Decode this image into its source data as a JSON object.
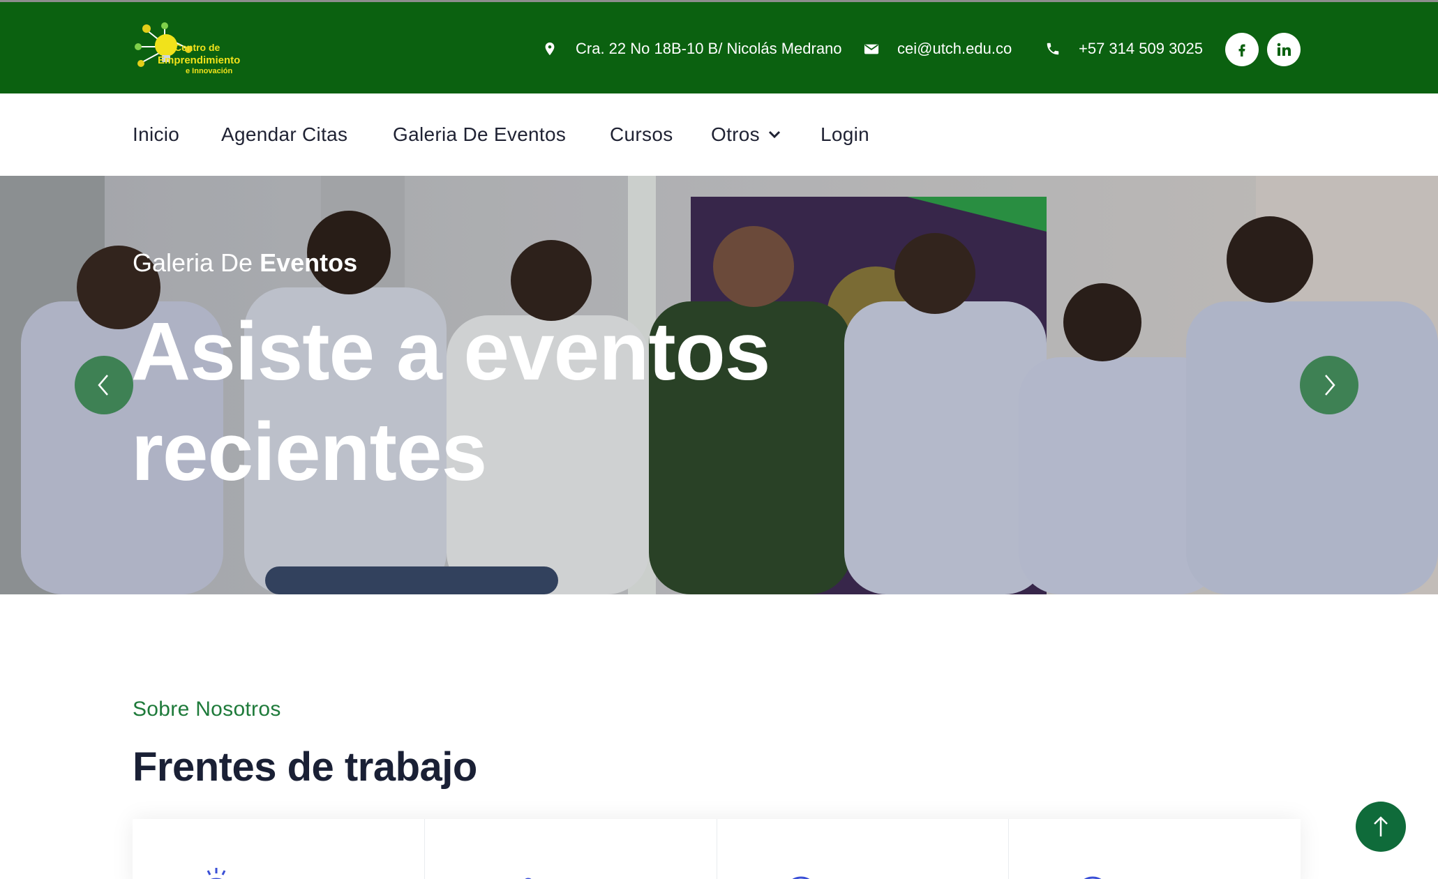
{
  "topbar": {
    "logo_text": [
      "Centro de",
      "Emprendimiento",
      "e Innovación"
    ],
    "logo_icon": "lightbulb-network-icon",
    "address": "Cra. 22 No 18B-10 B/ Nicolás Medrano",
    "email": "cei@utch.edu.co",
    "phone": "+57 314 509 3025",
    "social": [
      "facebook",
      "linkedin"
    ],
    "colors": {
      "background": "#0b6110",
      "text": "#ffffff"
    }
  },
  "nav": {
    "items": [
      {
        "label": "Inicio"
      },
      {
        "label": "Agendar Citas"
      },
      {
        "label": "Galeria De Eventos"
      },
      {
        "label": "Cursos"
      },
      {
        "label": "Otros",
        "has_dropdown": true
      },
      {
        "label": "Login"
      }
    ]
  },
  "hero": {
    "kicker_light": "Galeria De",
    "kicker_bold": "Eventos",
    "title_line1": "Asiste a eventos",
    "title_line2": "recientes",
    "prev_icon": "chevron-left-icon",
    "next_icon": "chevron-right-icon"
  },
  "about": {
    "kicker": "Sobre Nosotros",
    "title": "Frentes de trabajo",
    "accent_color": "#1e7a3a"
  },
  "scroll_top_icon": "arrow-up-icon"
}
